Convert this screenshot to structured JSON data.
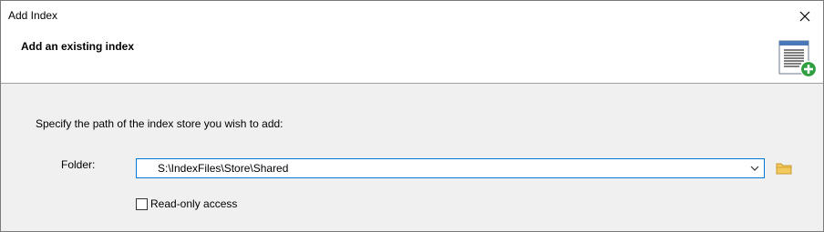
{
  "window": {
    "title": "Add Index"
  },
  "header": {
    "title": "Add an existing index",
    "icon": "index-add-icon"
  },
  "content": {
    "instruction": "Specify the path of the index store you wish to add:",
    "folder_label": "Folder:",
    "folder_value": "S:\\IndexFiles\\Store\\Shared",
    "readonly_label": "Read-only access",
    "readonly_checked": false
  },
  "icons": {
    "close": "close-icon",
    "dropdown": "chevron-down-icon",
    "browse": "folder-icon"
  },
  "colors": {
    "accent_border": "#0078d7",
    "folder_yellow": "#e8b84a",
    "plus_green": "#2e9e3e"
  }
}
